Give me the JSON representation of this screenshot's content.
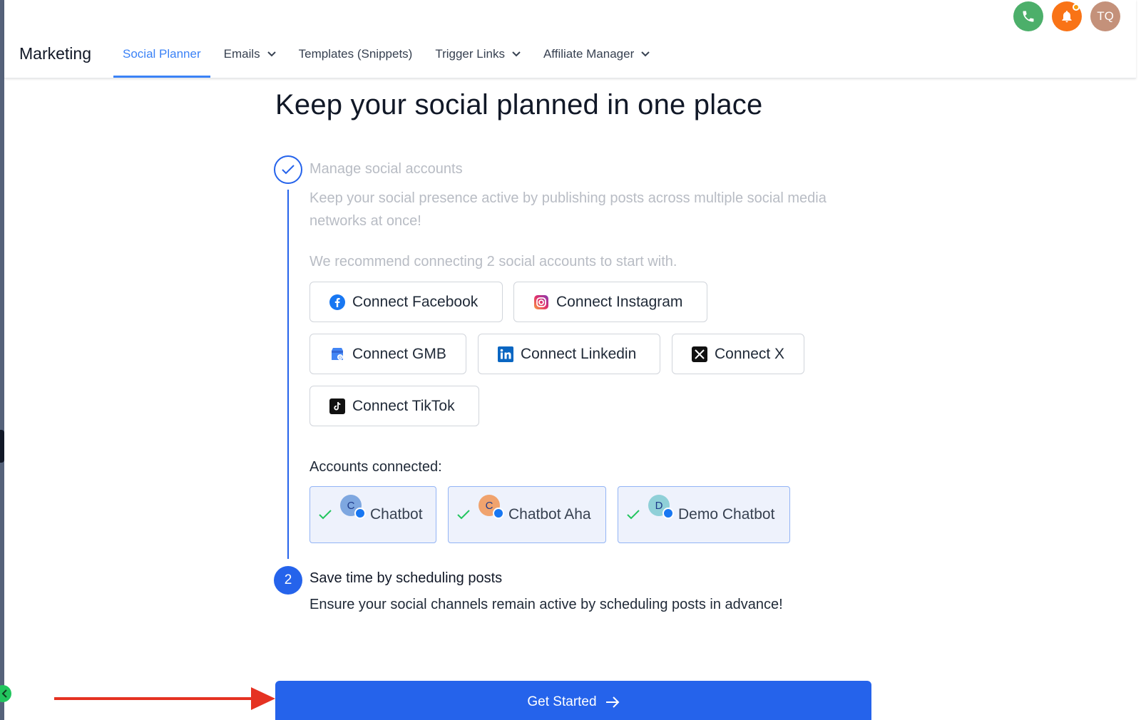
{
  "header": {
    "brand": "Marketing",
    "tabs": [
      {
        "label": "Social Planner",
        "active": true,
        "dropdown": false
      },
      {
        "label": "Emails",
        "active": false,
        "dropdown": true
      },
      {
        "label": "Templates (Snippets)",
        "active": false,
        "dropdown": false
      },
      {
        "label": "Trigger Links",
        "active": false,
        "dropdown": true
      },
      {
        "label": "Affiliate Manager",
        "active": false,
        "dropdown": true
      }
    ],
    "icons": {
      "phone": "phone-icon",
      "bell": "bell-icon"
    },
    "avatar_initials": "TQ",
    "colors": {
      "phone": "#4caf6a",
      "bell": "#f97316",
      "avatar": "#c4917a",
      "accent": "#3b82f6"
    }
  },
  "page": {
    "title": "Keep your social planned in one place"
  },
  "step1": {
    "title": "Manage social accounts",
    "description": "Keep your social presence active by publishing posts across multiple social media networks at once!",
    "recommend": "We recommend connecting 2 social accounts to start with."
  },
  "connect_buttons": [
    {
      "label": "Connect Facebook",
      "icon": "facebook-icon"
    },
    {
      "label": "Connect Instagram",
      "icon": "instagram-icon"
    },
    {
      "label": "Connect GMB",
      "icon": "gmb-icon"
    },
    {
      "label": "Connect Linkedin",
      "icon": "linkedin-icon"
    },
    {
      "label": "Connect X",
      "icon": "x-icon"
    },
    {
      "label": "Connect TikTok",
      "icon": "tiktok-icon"
    }
  ],
  "accounts": {
    "label": "Accounts connected:",
    "items": [
      {
        "name": "Chatbot",
        "initial": "C",
        "avatar_color": "#7ea7e0"
      },
      {
        "name": "Chatbot Aha",
        "initial": "C",
        "avatar_color": "#f0a36e"
      },
      {
        "name": "Demo Chatbot",
        "initial": "D",
        "avatar_color": "#8fd0d8"
      }
    ]
  },
  "step2": {
    "number": "2",
    "title": "Save time by scheduling posts",
    "description": "Ensure your social channels remain active by scheduling posts in advance!"
  },
  "cta": {
    "label": "Get Started",
    "color": "#2563eb"
  }
}
